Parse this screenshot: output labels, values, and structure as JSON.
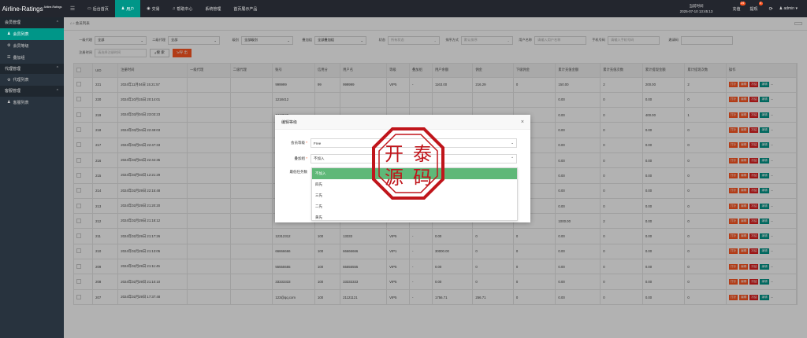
{
  "brand": {
    "name": "Airline-Ratings",
    "sup": "Airline-Ratings"
  },
  "topnav": [
    {
      "icon": "▭",
      "label": "后台首页"
    },
    {
      "icon": "♟",
      "label": "用户"
    },
    {
      "icon": "◉",
      "label": "交易"
    },
    {
      "icon": "♫",
      "label": "帮助中心"
    },
    {
      "icon": "",
      "label": "系统管理"
    },
    {
      "icon": "",
      "label": "首页展示产品"
    }
  ],
  "clock": {
    "label": "当前时间",
    "value": "2025-07-10 13:45:13"
  },
  "tools": {
    "recharge": "充值",
    "recharge_badge": "24",
    "withdraw": "提现",
    "withdraw_badge": "0",
    "admin": "admin"
  },
  "sidebar": {
    "groups": [
      {
        "label": "会员管理",
        "items": [
          {
            "icon": "♟",
            "label": "会员列表"
          },
          {
            "icon": "⚙",
            "label": "会员等级"
          },
          {
            "icon": "☰",
            "label": "叠加组"
          }
        ]
      },
      {
        "label": "代理管理",
        "items": [
          {
            "icon": "⚙",
            "label": "代理列表"
          }
        ]
      },
      {
        "label": "客服管理",
        "items": [
          {
            "icon": "♟",
            "label": "客服列表"
          }
        ]
      }
    ]
  },
  "tabs": {
    "current": "会员列表",
    "close_btn": ""
  },
  "filters": {
    "agent1_label": "一级代理",
    "agent1_value": "全部",
    "agent2_label": "二级代理",
    "agent2_value": "全部",
    "level_label": "级别",
    "level_value": "全部级别",
    "group_label": "叠加组",
    "group_value": "全部叠加组",
    "status_label": "状态",
    "status_ph": "所有状态",
    "sort_label": "排序方式",
    "sort_ph": "默认排序",
    "username_label": "用户名称",
    "username_ph": "请输入用户名称",
    "phone_label": "手机号码",
    "phone_ph": "请输入手机号码",
    "invite_label": "邀请码",
    "invite_ph": "",
    "regtime_label": "注册时间",
    "regtime_ph": "请选择注册时间",
    "search_btn": "搜 索",
    "export_btn": "导 出"
  },
  "table": {
    "headers": [
      "",
      "UID",
      "注册时间",
      "一级代理",
      "二级代理",
      "账号",
      "信用分",
      "用户名",
      "等级",
      "叠加组",
      "用户余额",
      "佣金",
      "下级佣金",
      "累计充值金额",
      "累计充值次数",
      "累计提现金额",
      "累计提现次数",
      "操作"
    ],
    "rows": [
      [
        "221",
        "2024年11月04日 15:21:57",
        "",
        "",
        "999999",
        "99",
        "999999",
        "VIP5",
        "-",
        "1163.00",
        "216.29",
        "0",
        "150.00",
        "2",
        "200.00",
        "2"
      ],
      [
        "220",
        "2024年10月15日 20:14:01",
        "",
        "",
        "1218412",
        "",
        "",
        "",
        "",
        "",
        "",
        "",
        "0.00",
        "0",
        "0.00",
        "0"
      ],
      [
        "219",
        "2024年03月04日 23:03:23",
        "",
        "",
        "7418529",
        "",
        "",
        "",
        "",
        "",
        "",
        "",
        "0.00",
        "0",
        "400.00",
        "1"
      ],
      [
        "218",
        "2024年03月04日 22:49:03",
        "",
        "",
        "1122334",
        "",
        "",
        "",
        "",
        "",
        "",
        "",
        "0.00",
        "0",
        "0.00",
        "0"
      ],
      [
        "217",
        "2024年03月04日 22:47:33",
        "",
        "",
        "3456789",
        "",
        "",
        "",
        "",
        "",
        "",
        "",
        "0.00",
        "0",
        "0.00",
        "0"
      ],
      [
        "216",
        "2024年03月04日 22:44:35",
        "",
        "",
        "7778888",
        "",
        "",
        "",
        "",
        "",
        "",
        "",
        "0.00",
        "0",
        "0.00",
        "0"
      ],
      [
        "215",
        "2024年03月03日 12:21:29",
        "",
        "",
        "888888",
        "",
        "",
        "",
        "",
        "",
        "",
        "",
        "0.00",
        "0",
        "0.00",
        "0"
      ],
      [
        "214",
        "2024年02月29日 22:15:48",
        "",
        "",
        "1231231",
        "",
        "",
        "",
        "",
        "",
        "",
        "",
        "0.00",
        "0",
        "0.00",
        "0"
      ],
      [
        "213",
        "2024年02月29日 21:20:20",
        "",
        "",
        "1231@qq.com",
        "100",
        "112132112",
        "VIP5",
        "-",
        "0.00",
        "0",
        "0",
        "0.00",
        "0",
        "0.00",
        "0"
      ],
      [
        "212",
        "2024年02月29日 21:18:12",
        "",
        "",
        "777777",
        "100",
        "777777",
        "VIP5",
        "-",
        "1320.97",
        "320.97",
        "0",
        "1000.00",
        "2",
        "0.00",
        "0"
      ],
      [
        "211",
        "2024年02月29日 21:17:26",
        "",
        "",
        "12312312",
        "100",
        "13333",
        "VIP5",
        "-",
        "0.00",
        "0",
        "0",
        "0.00",
        "0",
        "0.00",
        "0"
      ],
      [
        "210",
        "2024年02月29日 21:13:05",
        "",
        "",
        "66666666",
        "100",
        "66666666",
        "VIP1",
        "-",
        "30000.00",
        "0",
        "0",
        "0.00",
        "0",
        "0.00",
        "0"
      ],
      [
        "209",
        "2024年02月29日 21:11:45",
        "",
        "",
        "55555555",
        "100",
        "55555555",
        "VIP5",
        "-",
        "0.00",
        "0",
        "0",
        "0.00",
        "0",
        "0.00",
        "0"
      ],
      [
        "208",
        "2024年02月29日 21:10:10",
        "",
        "",
        "33333333",
        "100",
        "33333333",
        "VIP5",
        "-",
        "0.00",
        "0",
        "0",
        "0.00",
        "0",
        "0.00",
        "0"
      ],
      [
        "207",
        "2024年02月29日 17:37:48",
        "",
        "",
        "123@qq.com",
        "100",
        "21121121",
        "VIP5",
        "-",
        "1756.71",
        "256.71",
        "0",
        "0.00",
        "0",
        "0.00",
        "0"
      ]
    ],
    "actions": [
      "打针",
      "编辑",
      "冻结",
      "编辑",
      "..."
    ]
  },
  "modal": {
    "title": "编辑等级",
    "close": "×",
    "level_label": "会员等级",
    "level_value": "Free",
    "group_label": "叠加组",
    "group_value": "不加入",
    "count_label": "最低任务数",
    "required": "*"
  },
  "dropdown": {
    "options": [
      "不加入",
      "四先",
      "三先",
      "二先",
      "黄先"
    ]
  },
  "stamp": {
    "chars": [
      "开",
      "泰",
      "源",
      "码"
    ]
  },
  "colors": {
    "accent": "#009688",
    "danger": "#ff5722",
    "dark": "#23262e"
  }
}
